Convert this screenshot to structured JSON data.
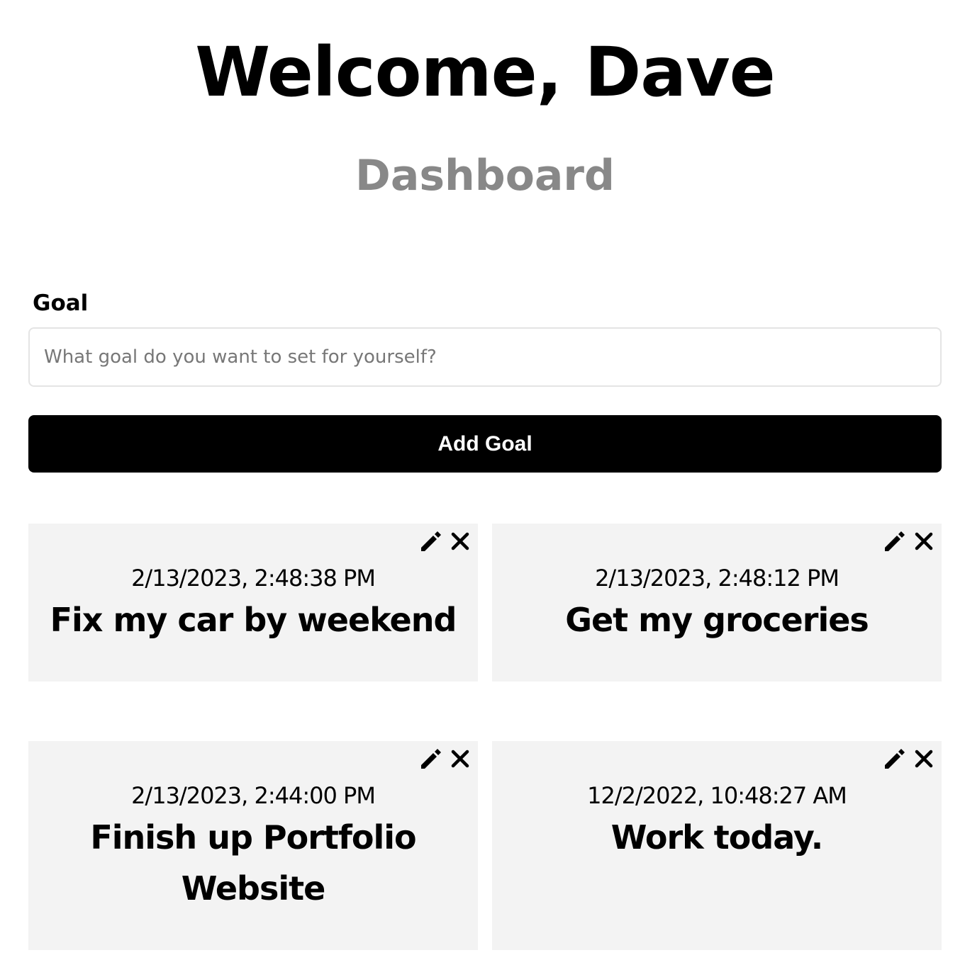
{
  "header": {
    "title": "Welcome, Dave",
    "subtitle": "Dashboard"
  },
  "form": {
    "label": "Goal",
    "input_placeholder": "What goal do you want to set for yourself?",
    "input_value": "",
    "submit_label": "Add Goal"
  },
  "goals": [
    {
      "date": "2/13/2023, 2:48:38 PM",
      "text": "Fix my car by weekend",
      "edit_icon": "pencil-icon",
      "delete_icon": "close-icon"
    },
    {
      "date": "2/13/2023, 2:48:12 PM",
      "text": "Get my groceries",
      "edit_icon": "pencil-icon",
      "delete_icon": "close-icon"
    },
    {
      "date": "2/13/2023, 2:44:00 PM",
      "text": "Finish up Portfolio Website",
      "edit_icon": "pencil-icon",
      "delete_icon": "close-icon"
    },
    {
      "date": "12/2/2022, 10:48:27 AM",
      "text": "Work today.",
      "edit_icon": "pencil-icon",
      "delete_icon": "close-icon"
    }
  ],
  "colors": {
    "background": "#ffffff",
    "subtitle": "#888888",
    "button": "#000000",
    "card_background": "#f3f3f3"
  }
}
